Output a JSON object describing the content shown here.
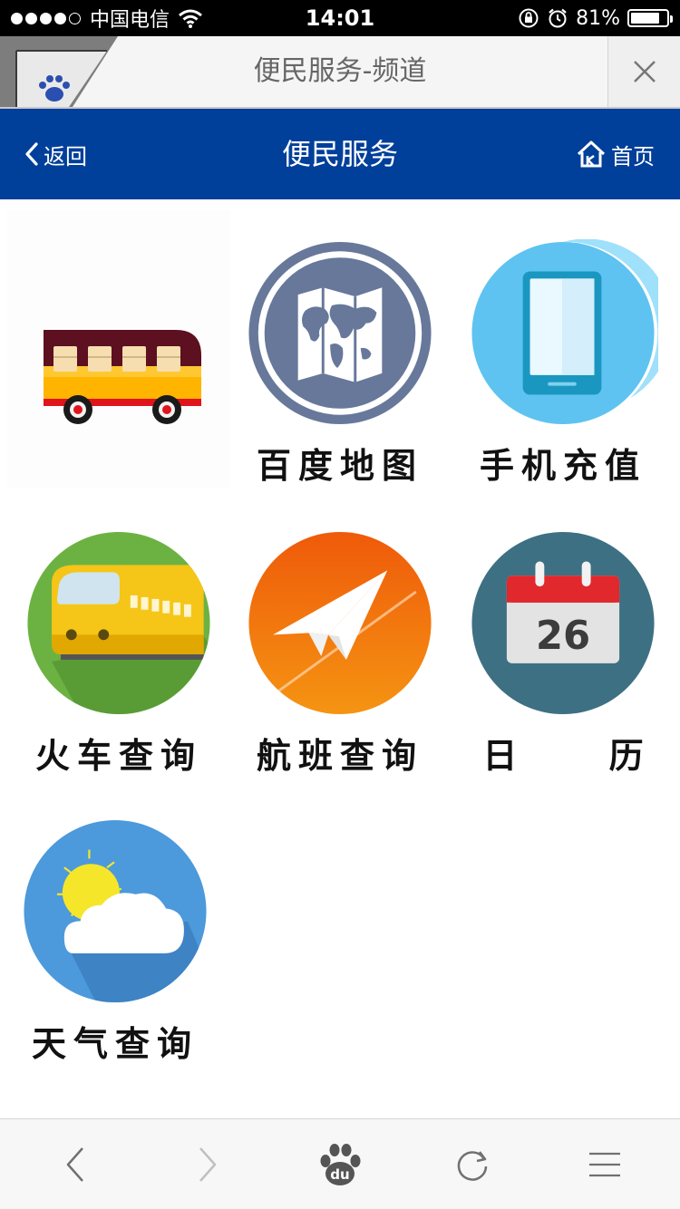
{
  "status_bar": {
    "carrier": "中国电信",
    "time": "14:01",
    "battery_percent": "81%",
    "battery_level": 0.81,
    "signal_bars": 4
  },
  "browser_tab": {
    "title": "便民服务-频道",
    "close_icon": "close-icon"
  },
  "header": {
    "back_label": "返回",
    "title": "便民服务",
    "home_label": "首页",
    "bg_color": "#003f9a"
  },
  "services": [
    {
      "label": "",
      "icon": "bus-icon"
    },
    {
      "label": "百度地图",
      "icon": "map-icon"
    },
    {
      "label": "手机充值",
      "icon": "phone-icon"
    },
    {
      "label": "火车查询",
      "icon": "train-icon"
    },
    {
      "label": "航班查询",
      "icon": "paper-plane-icon"
    },
    {
      "label": "日 历",
      "icon": "calendar-icon",
      "calendar_day": "26"
    },
    {
      "label": "天气查询",
      "icon": "weather-icon"
    }
  ],
  "toolbar": {
    "items": [
      "back-icon",
      "forward-icon",
      "baidu-icon",
      "refresh-icon",
      "menu-icon"
    ],
    "baidu_text": "du"
  }
}
